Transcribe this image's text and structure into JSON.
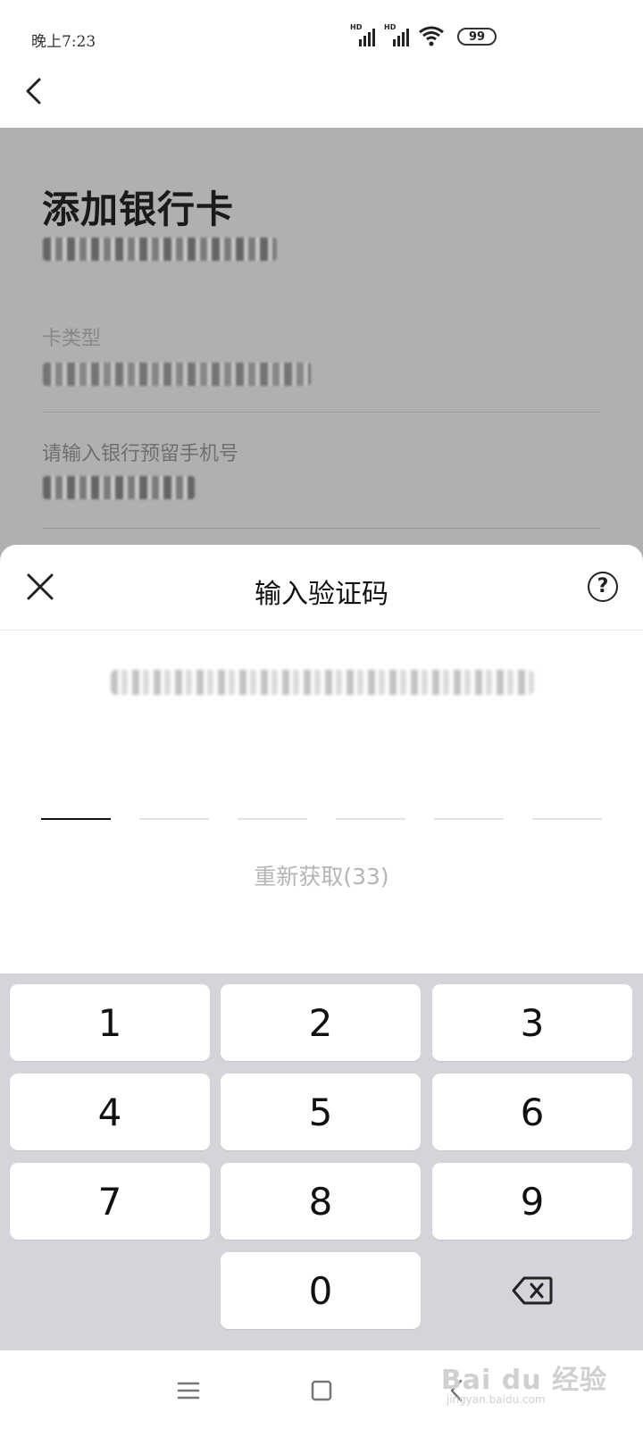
{
  "status_bar": {
    "time": "晚上7:23",
    "signal1_label": "HD",
    "signal2_label": "HD",
    "battery": "99"
  },
  "page": {
    "title": "添加银行卡",
    "card_type_label": "卡类型",
    "phone_label": "请输入银行预留手机号"
  },
  "sheet": {
    "title": "输入验证码",
    "help_symbol": "?",
    "code_length": 6,
    "resend": "重新获取(33)"
  },
  "keypad": {
    "keys": [
      "1",
      "2",
      "3",
      "4",
      "5",
      "6",
      "7",
      "8",
      "9",
      "0"
    ]
  },
  "watermark": {
    "brand": "Bai du 经验",
    "url": "jingyan.baidu.com"
  },
  "icons": {
    "back": "chevron-left-icon",
    "close": "close-icon",
    "help": "question-circle-icon",
    "delete": "backspace-icon",
    "menu": "menu-icon",
    "home": "home-icon",
    "sys_back": "back-triangle-icon"
  }
}
